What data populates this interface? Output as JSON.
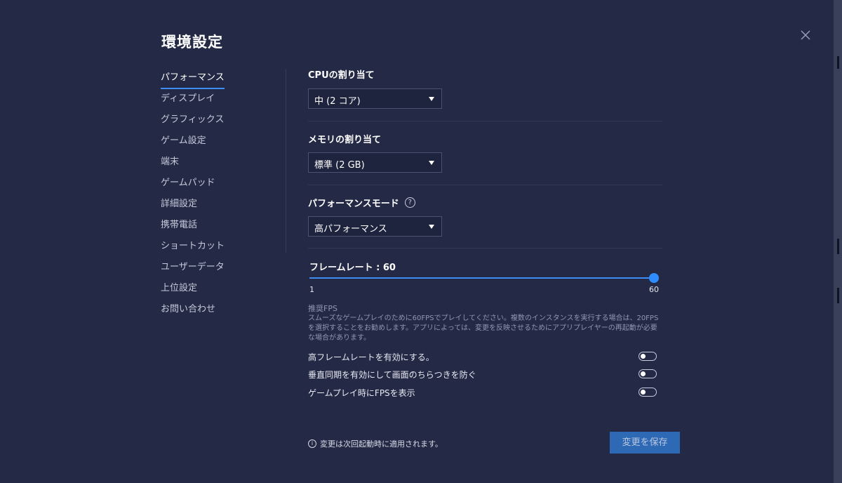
{
  "window": {
    "title": "環境設定",
    "close_icon": "close-icon"
  },
  "sidebar": {
    "items": [
      {
        "label": "パフォーマンス",
        "active": true
      },
      {
        "label": "ディスプレイ"
      },
      {
        "label": "グラフィックス"
      },
      {
        "label": "ゲーム設定"
      },
      {
        "label": "端末"
      },
      {
        "label": "ゲームパッド"
      },
      {
        "label": "詳細設定"
      },
      {
        "label": "携帯電話"
      },
      {
        "label": "ショートカット"
      },
      {
        "label": "ユーザーデータ"
      },
      {
        "label": "上位設定"
      },
      {
        "label": "お問い合わせ"
      }
    ]
  },
  "performance": {
    "cpu": {
      "label": "CPUの割り当て",
      "value": "中 (2 コア)"
    },
    "memory": {
      "label": "メモリの割り当て",
      "value": "標準 (2 GB)"
    },
    "mode": {
      "label": "パフォーマンスモード",
      "help_icon": "?",
      "value": "高パフォーマンス"
    },
    "framerate": {
      "label": "フレームレート : 60",
      "min_label": "1",
      "max_label": "60",
      "min": 1,
      "max": 60,
      "value": 60
    },
    "recommendation": {
      "title": "推奨FPS",
      "text": "スムーズなゲームプレイのために60FPSでプレイしてください。複数のインスタンスを実行する場合は、20FPSを選択することをお勧めします。アプリによっては、変更を反映させるためにアプリプレイヤーの再起動が必要な場合があります。"
    },
    "toggles": [
      {
        "label": "高フレームレートを有効にする。",
        "on": false
      },
      {
        "label": "垂直同期を有効にして画面のちらつきを防ぐ",
        "on": false
      },
      {
        "label": "ゲームプレイ時にFPSを表示",
        "on": false
      }
    ]
  },
  "footer": {
    "info_icon": "i",
    "note": "変更は次回起動時に適用されます。",
    "save_label": "変更を保存"
  },
  "colors": {
    "background": "#242a46",
    "accent": "#3d8df5",
    "save_button": "#2d69b5"
  }
}
